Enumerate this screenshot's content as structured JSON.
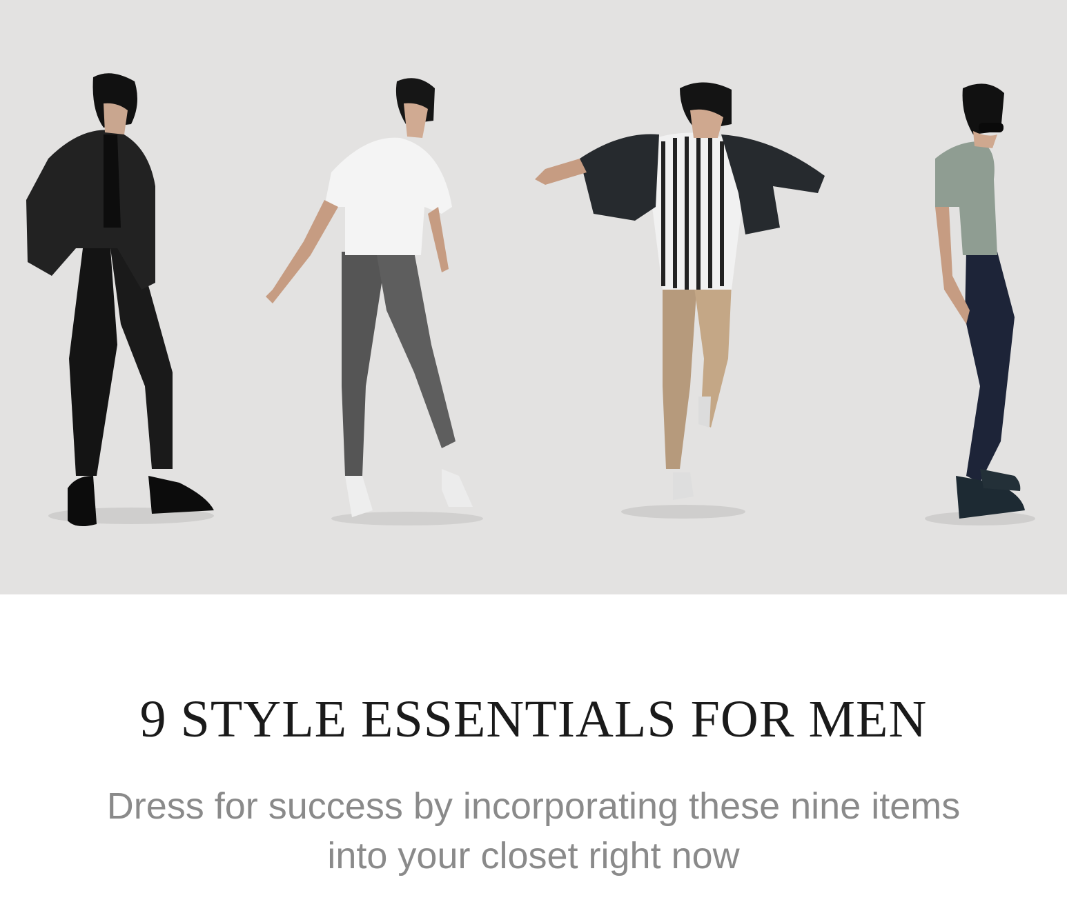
{
  "article": {
    "title": "9 STYLE ESSENTIALS FOR MEN",
    "subtitle": "Dress for success by incorporating these nine items into your closet right now"
  },
  "hero": {
    "background_color": "#e3e2e1",
    "models": [
      {
        "outfit": "black quilted bomber jacket, black tee, black trousers, black sneakers"
      },
      {
        "outfit": "white short-sleeve shirt, grey trousers, white sneakers"
      },
      {
        "outfit": "striped tee, open dark jacket, khaki chinos"
      },
      {
        "outfit": "sage polo, sunglasses, navy trousers, dark skate shoes"
      }
    ]
  },
  "colors": {
    "title": "#1a1a1a",
    "subtitle": "#8a8a8a",
    "page_background": "#ffffff"
  }
}
